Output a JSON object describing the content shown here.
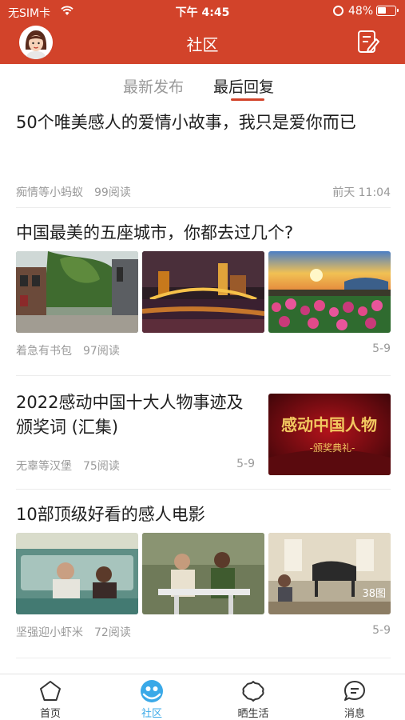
{
  "status_bar": {
    "carrier": "无SIM卡",
    "time": "下午 4:45",
    "battery": "48%",
    "battery_level": 0.48
  },
  "nav": {
    "title": "社区"
  },
  "tabs": {
    "new_label": "最新发布",
    "last_label": "最后回复",
    "selected": "最后回复"
  },
  "articles": [
    {
      "title": "50个唯美感人的爱情小故事，我只是爱你而已",
      "author": "痴情等小蚂蚁",
      "reads": "99阅读",
      "date": "前天 11:04"
    },
    {
      "title": "中国最美的五座城市，你都去过几个?",
      "author": "着急有书包",
      "reads": "97阅读",
      "date": "5-9"
    },
    {
      "title": "2022感动中国十大人物事迹及颁奖词 (汇集)",
      "author": "无辜等汉堡",
      "reads": "75阅读",
      "date": "5-9",
      "thumb_text": "感动中国人物",
      "thumb_subtext": "-颁奖典礼-"
    },
    {
      "title": "10部顶级好看的感人电影",
      "author": "坚强迎小虾米",
      "reads": "72阅读",
      "date": "5-9",
      "photo_count": "38图"
    }
  ],
  "tabbar": {
    "items": [
      {
        "label": "首页",
        "icon": "pentagon-icon"
      },
      {
        "label": "社区",
        "icon": "community-icon"
      },
      {
        "label": "晒生活",
        "icon": "flower-icon"
      },
      {
        "label": "消息",
        "icon": "chat-bubble-icon"
      }
    ],
    "active": "社区"
  },
  "colors": {
    "brand": "#d2432a",
    "active_tab": "#3aa9e8"
  }
}
